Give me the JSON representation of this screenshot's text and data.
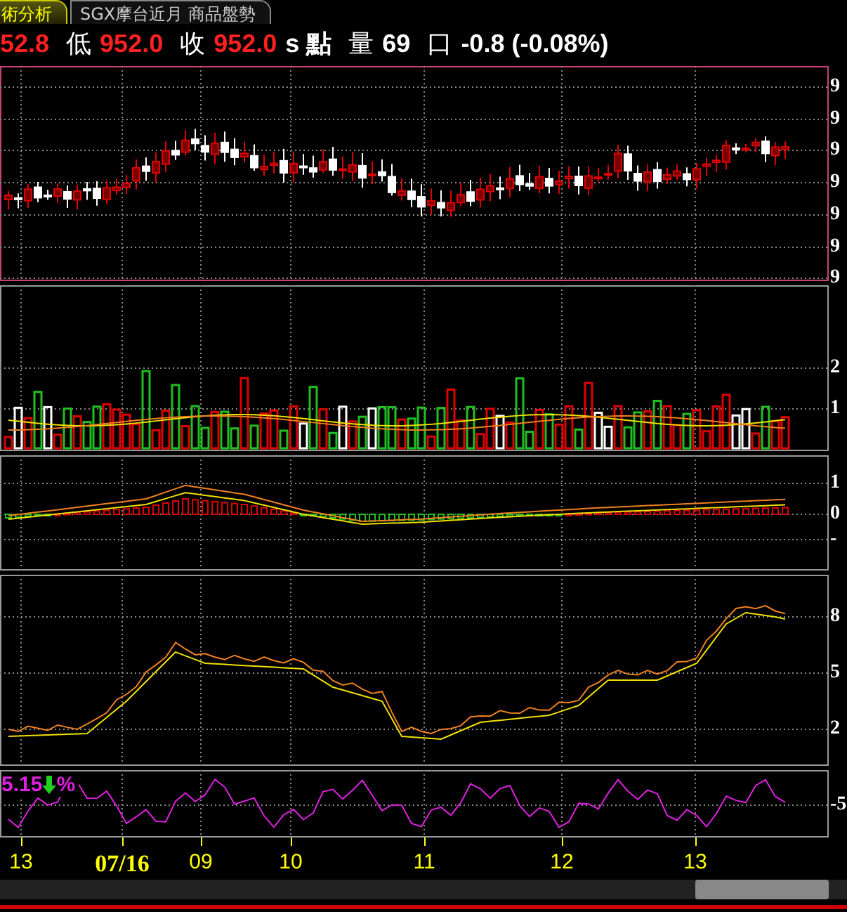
{
  "tabs": [
    {
      "label": "術分析",
      "selected": true
    },
    {
      "label": "SGX摩台近月 商品盤勢",
      "selected": false
    }
  ],
  "quote": [
    {
      "text": "52.8",
      "kind": "price"
    },
    {
      "text": "低",
      "kind": "label"
    },
    {
      "text": "952.0",
      "kind": "price"
    },
    {
      "text": "收",
      "kind": "label"
    },
    {
      "text": "952.0",
      "kind": "price"
    },
    {
      "text": "s 點",
      "kind": "value"
    },
    {
      "text": "量",
      "kind": "label"
    },
    {
      "text": "69",
      "kind": "value"
    },
    {
      "text": "口",
      "kind": "label"
    },
    {
      "text": "-0.8 (-0.08%)",
      "kind": "value"
    }
  ],
  "panels": [
    {
      "kind": "candles",
      "axis_labels": [
        "9",
        "9",
        "9",
        "9",
        "9",
        "9",
        "9"
      ]
    },
    {
      "kind": "volume",
      "axis_labels": [
        "2",
        "1"
      ]
    },
    {
      "kind": "macd",
      "axis_labels": [
        "1",
        "0",
        "-"
      ]
    },
    {
      "kind": "kd",
      "axis_labels": [
        "8",
        "5",
        "2"
      ]
    },
    {
      "kind": "line",
      "axis_labels": [
        "-5"
      ],
      "legend": {
        "value": "5.15",
        "unit": "%"
      }
    }
  ],
  "x_axis": [
    {
      "text": "13",
      "bold": false
    },
    {
      "text": "07/16",
      "bold": true
    },
    {
      "text": "09",
      "bold": false
    },
    {
      "text": "10",
      "bold": false
    },
    {
      "text": "11",
      "bold": false
    },
    {
      "text": "12",
      "bold": false
    },
    {
      "text": "13",
      "bold": false
    }
  ]
}
